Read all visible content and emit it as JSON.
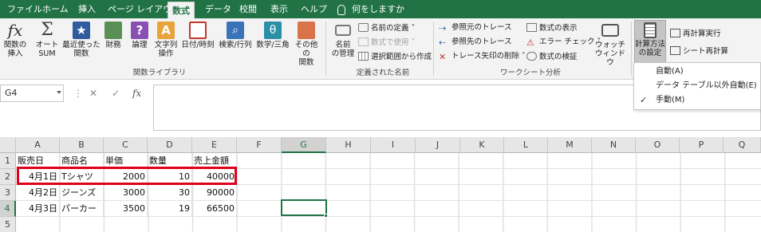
{
  "tabs": [
    {
      "label": "ファイル"
    },
    {
      "label": "ホーム"
    },
    {
      "label": "挿入"
    },
    {
      "label": "ページ レイアウト"
    },
    {
      "label": "数式"
    },
    {
      "label": "データ"
    },
    {
      "label": "校閲"
    },
    {
      "label": "表示"
    },
    {
      "label": "ヘルプ"
    }
  ],
  "active_tab": "数式",
  "tell_me": "何をしますか",
  "ribbon": {
    "insert_function": "関数の\n挿入",
    "autosum": "オート\nSUM",
    "recent": "最近使った\n関数",
    "financial": "財務",
    "logical": "論理",
    "text": "文字列\n操作",
    "datetime": "日付/時刻",
    "lookup": "検索/行列",
    "math": "数学/三角",
    "more": "その他の\n関数",
    "group_library": "関数ライブラリ",
    "name_manager": "名前\nの管理",
    "define_name": "名前の定義",
    "use_in_formula": "数式で使用",
    "create_from_selection": "選択範囲から作成",
    "group_defined_names": "定義された名前",
    "trace_precedents": "参照元のトレース",
    "trace_dependents": "参照先のトレース",
    "remove_arrows": "トレース矢印の削除",
    "show_formulas": "数式の表示",
    "error_checking": "エラー チェック",
    "evaluate_formula": "数式の検証",
    "group_auditing": "ワークシート分析",
    "watch_window": "ウォッチ\nウィンドウ",
    "calc_options": "計算方法\nの設定",
    "calc_now": "再計算実行",
    "calc_sheet": "シート再計算"
  },
  "calc_menu": {
    "items": [
      {
        "label": "自動(A)",
        "checked": false
      },
      {
        "label": "データ テーブル以外自動(E)",
        "checked": false
      },
      {
        "label": "手動(M)",
        "checked": true
      }
    ]
  },
  "formula_bar": {
    "name_box": "G4",
    "cancel": "✕",
    "enter": "✓",
    "fx": "fx",
    "content": ""
  },
  "grid": {
    "columns": [
      "A",
      "B",
      "C",
      "D",
      "E",
      "F",
      "G",
      "H",
      "I",
      "J",
      "K",
      "L",
      "M",
      "N",
      "O",
      "P",
      "Q"
    ],
    "selected_column": "G",
    "row_numbers": [
      "1",
      "2",
      "3",
      "4",
      "5"
    ],
    "selected_row": "4",
    "header_row": [
      "販売日",
      "商品名",
      "単価",
      "数量",
      "売上金額"
    ],
    "rows": [
      [
        "4月1日",
        "Tシャツ",
        "2000",
        "10",
        "40000"
      ],
      [
        "4月2日",
        "ジーンズ",
        "3000",
        "30",
        "90000"
      ],
      [
        "4月3日",
        "パーカー",
        "3500",
        "19",
        "66500"
      ]
    ],
    "active_cell": "G4"
  },
  "colors": {
    "accent": "#217346",
    "highlight": "#e0001b"
  }
}
